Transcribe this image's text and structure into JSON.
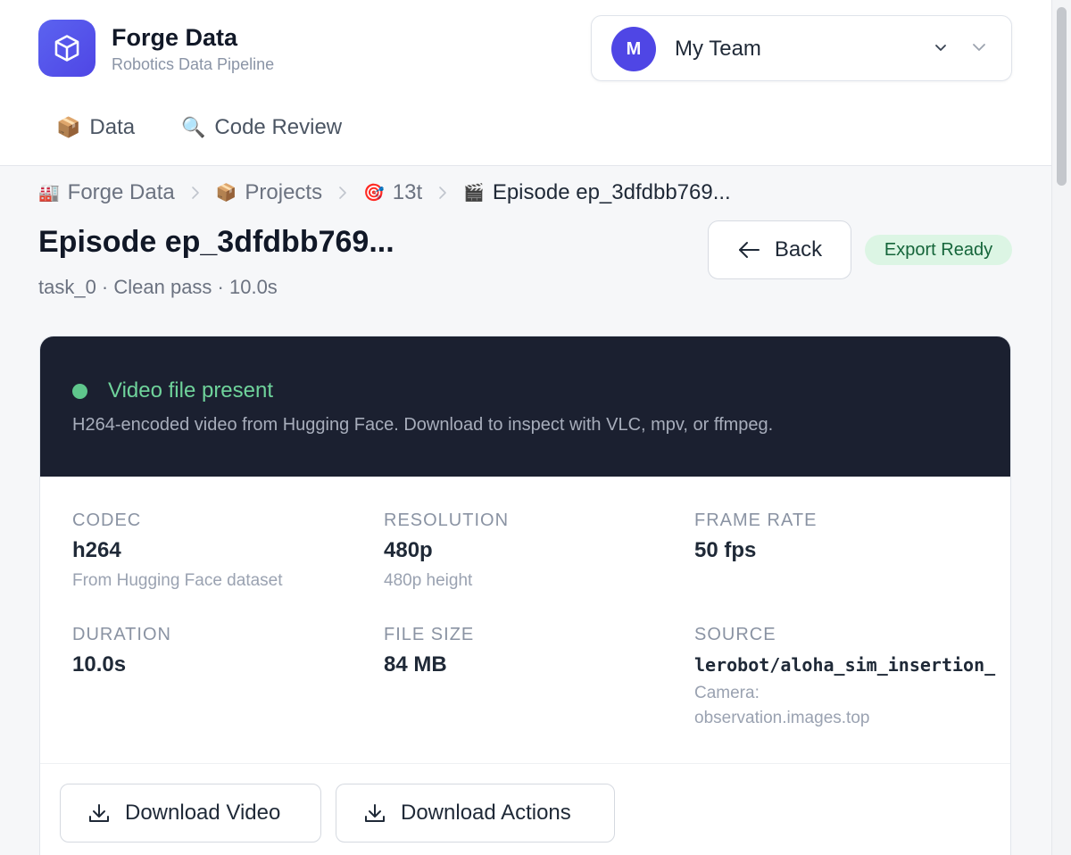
{
  "brand": {
    "name": "Forge Data",
    "subtitle": "Robotics Data Pipeline",
    "logo_icon": "cube-icon",
    "accent": "#4f46e5"
  },
  "team": {
    "avatar_initial": "M",
    "name": "My Team"
  },
  "nav": {
    "tabs": [
      {
        "icon": "📦",
        "label": "Data"
      },
      {
        "icon": "🔍",
        "label": "Code Review"
      }
    ]
  },
  "breadcrumb": [
    {
      "icon": "🏭",
      "label": "Forge Data"
    },
    {
      "icon": "📦",
      "label": "Projects"
    },
    {
      "icon": "🎯",
      "label": "13t"
    },
    {
      "icon": "🎬",
      "label": "Episode ep_3dfdbb769..."
    }
  ],
  "page": {
    "title": "Episode ep_3dfdbb769...",
    "subtitle": "task_0 · Clean pass · 10.0s"
  },
  "actions": {
    "back_label": "Back",
    "status_badge": "Export Ready"
  },
  "video": {
    "status_title": "Video file present",
    "status_description": "H264-encoded video from Hugging Face. Download to inspect with VLC, mpv, or ffmpeg.",
    "codec": {
      "label": "CODEC",
      "value": "h264",
      "note": "From Hugging Face dataset"
    },
    "resolution": {
      "label": "RESOLUTION",
      "value": "480p",
      "note": "480p height"
    },
    "frame_rate": {
      "label": "FRAME RATE",
      "value": "50 fps"
    },
    "duration": {
      "label": "DURATION",
      "value": "10.0s"
    },
    "file_size": {
      "label": "FILE SIZE",
      "value": "84 MB"
    },
    "source": {
      "label": "SOURCE",
      "value": "lerobot/aloha_sim_insertion_",
      "note_line1": "Camera:",
      "note_line2": "observation.images.top"
    }
  },
  "downloads": {
    "video_label": "Download Video",
    "actions_label": "Download Actions"
  }
}
